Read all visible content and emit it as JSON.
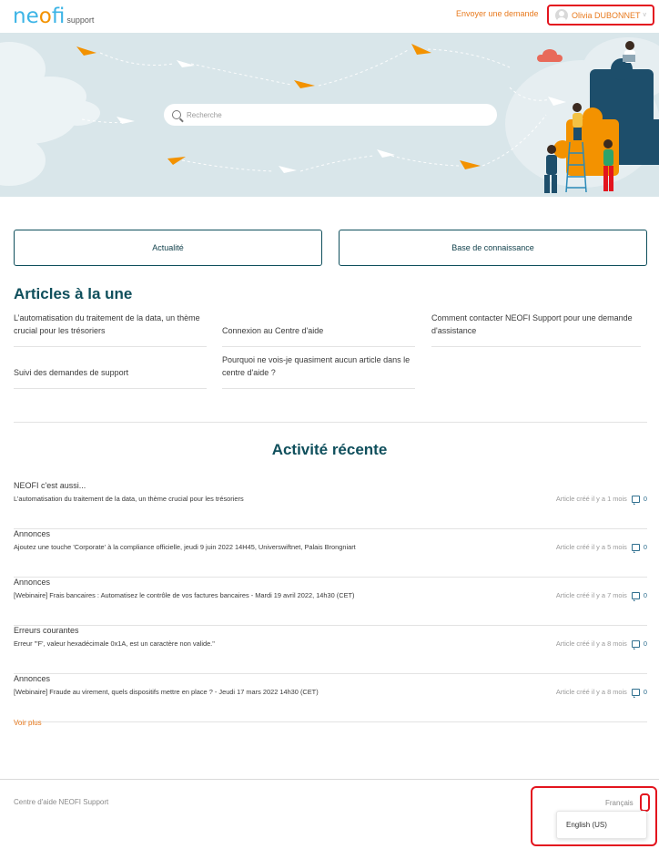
{
  "header": {
    "logo_main_prefix": "ne",
    "logo_main_o": "o",
    "logo_main_suffix": "fi",
    "logo_sub": "support",
    "submit_request": "Envoyer une demande",
    "user_name": "Olivia DUBONNET",
    "user_chevron": "v"
  },
  "search": {
    "placeholder": "Recherche"
  },
  "categories": [
    {
      "label": "Actualité"
    },
    {
      "label": "Base de connaissance"
    }
  ],
  "promoted": {
    "title": "Articles à la une",
    "articles": [
      {
        "title": "L’automatisation du traitement de la data, un thème crucial pour les trésoriers"
      },
      {
        "title": "Connexion au Centre d'aide"
      },
      {
        "title": "Comment contacter NEOFI Support pour une demande d'assistance"
      },
      {
        "title": "Suivi des demandes de support"
      },
      {
        "title": "Pourquoi ne vois-je quasiment aucun article dans le centre d'aide ?"
      }
    ]
  },
  "recent": {
    "title": "Activité récente",
    "items": [
      {
        "category": "NEOFI c'est aussi...",
        "article": "L’automatisation du traitement de la data, un thème crucial pour les trésoriers",
        "meta": "Article créé il y a 1 mois",
        "comments": "0"
      },
      {
        "category": "Annonces",
        "article": "Ajoutez une touche 'Corporate' à la compliance officielle, jeudi 9 juin 2022 14H45, Universwiftnet, Palais Brongniart",
        "meta": "Article créé il y a 5 mois",
        "comments": "0"
      },
      {
        "category": "Annonces",
        "article": "[Webinaire] Frais bancaires : Automatisez le contrôle de vos factures bancaires - Mardi 19 avril 2022, 14h30 (CET)",
        "meta": "Article créé il y a 7 mois",
        "comments": "0"
      },
      {
        "category": "Erreurs courantes",
        "article": "Erreur \"'F', valeur hexadécimale 0x1A, est un caractère non valide.\"",
        "meta": "Article créé il y a 8 mois",
        "comments": "0"
      },
      {
        "category": "Annonces",
        "article": "[Webinaire] Fraude au virement, quels dispositifs mettre en place ? - Jeudi 17 mars 2022 14h30 (CET)",
        "meta": "Article créé il y a 8 mois",
        "comments": "0"
      }
    ],
    "see_more": "Voir plus"
  },
  "footer": {
    "help_center": "Centre d'aide NEOFI Support",
    "current_language": "Français",
    "language_option": "English (US)"
  },
  "colors": {
    "brand_blue": "#3cb4e6",
    "brand_orange": "#f39200",
    "link_orange": "#e87a1e",
    "heading_teal": "#0f4f5c",
    "highlight_red": "#e3141e",
    "hero_bg": "#d9e6ea"
  },
  "icons": [
    "user-avatar-icon",
    "chevron-down-icon",
    "search-icon",
    "comment-icon"
  ]
}
